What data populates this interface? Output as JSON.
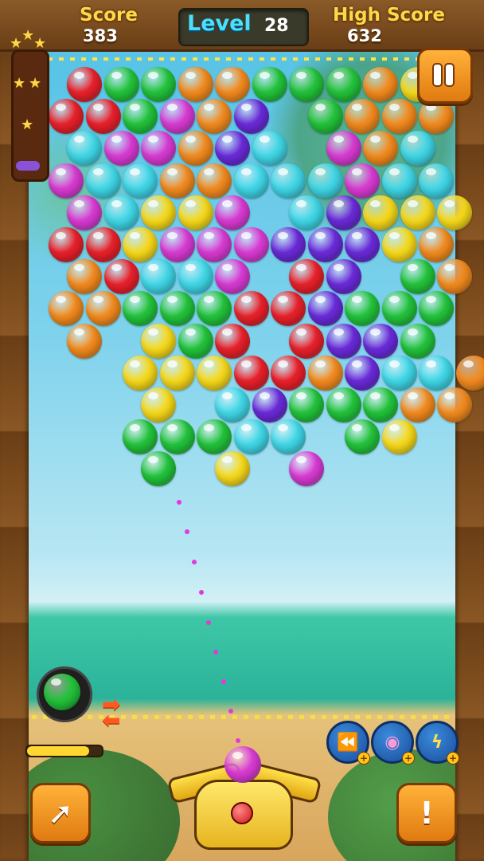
{
  "header": {
    "score_label": "Score",
    "score_value": "383",
    "level_label": "Level",
    "level_value": "28",
    "high_score_label": "High Score",
    "high_score_value": "632"
  },
  "colors": {
    "red": "#e8202a",
    "green": "#22c23a",
    "orange": "#f28a1e",
    "purple": "#6a2ad8",
    "cyan": "#3fd6e6",
    "magenta": "#d83ad2",
    "yellow": "#f6d81a"
  },
  "board": {
    "rows": [
      [
        "red",
        "green",
        "green",
        "orange",
        "orange",
        "green",
        "green",
        "green",
        "orange",
        "yellow"
      ],
      [
        "red",
        "red",
        "green",
        "magenta",
        "orange",
        "purple",
        "",
        "green",
        "orange",
        "orange",
        "orange"
      ],
      [
        "cyan",
        "magenta",
        "magenta",
        "orange",
        "purple",
        "cyan",
        "",
        "magenta",
        "orange",
        "cyan"
      ],
      [
        "magenta",
        "cyan",
        "cyan",
        "orange",
        "orange",
        "cyan",
        "cyan",
        "cyan",
        "magenta",
        "cyan",
        "cyan"
      ],
      [
        "magenta",
        "cyan",
        "yellow",
        "yellow",
        "magenta",
        "",
        "cyan",
        "purple",
        "yellow",
        "yellow",
        "yellow"
      ],
      [
        "red",
        "red",
        "yellow",
        "magenta",
        "magenta",
        "magenta",
        "purple",
        "purple",
        "purple",
        "yellow",
        "orange"
      ],
      [
        "orange",
        "red",
        "cyan",
        "cyan",
        "magenta",
        "",
        "red",
        "purple",
        "",
        "green",
        "orange"
      ],
      [
        "orange",
        "orange",
        "green",
        "green",
        "green",
        "red",
        "red",
        "purple",
        "green",
        "green",
        "green"
      ],
      [
        "orange",
        "",
        "yellow",
        "green",
        "red",
        "",
        "red",
        "purple",
        "purple",
        "green"
      ],
      [
        "",
        "",
        "yellow",
        "yellow",
        "yellow",
        "red",
        "red",
        "orange",
        "purple",
        "cyan",
        "cyan",
        "orange"
      ],
      [
        "",
        "",
        "yellow",
        "",
        "cyan",
        "purple",
        "green",
        "green",
        "green",
        "orange",
        "orange"
      ],
      [
        "",
        "",
        "green",
        "green",
        "green",
        "cyan",
        "cyan",
        "",
        "green",
        "yellow"
      ],
      [
        "",
        "",
        "green",
        "",
        "yellow",
        "",
        "magenta"
      ]
    ]
  },
  "next_ball_color": "green",
  "current_ball_color": "magenta",
  "power_meter_fraction": 0.83,
  "boosters": [
    {
      "icon": "rewind-icon"
    },
    {
      "icon": "bomb-icon"
    },
    {
      "icon": "lightning-icon"
    }
  ]
}
